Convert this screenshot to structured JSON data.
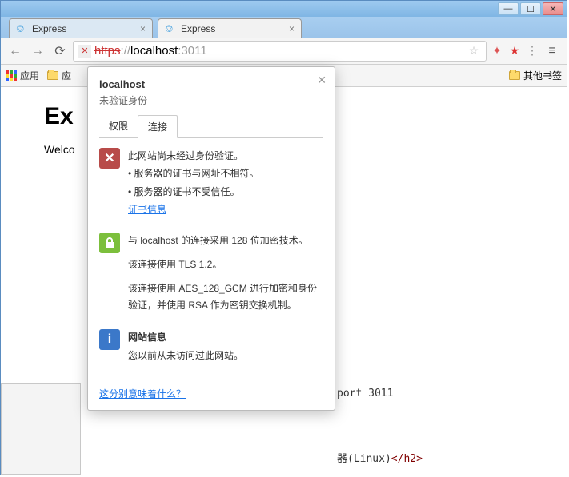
{
  "window": {
    "min": "—",
    "max": "☐",
    "close": "✕"
  },
  "tabs": [
    {
      "title": "Express",
      "active": false
    },
    {
      "title": "Express",
      "active": true
    }
  ],
  "toolbar": {
    "back": "←",
    "forward": "→",
    "reload": "⟳",
    "menu": "≡",
    "star": "☆",
    "ext1": "✦",
    "ext2": "★",
    "ext3": "⋮"
  },
  "url": {
    "scheme": "https",
    "slashes": "://",
    "host": "localhost",
    "port": ":3011",
    "warn": "✕"
  },
  "bookmarks": {
    "apps": "应用",
    "folder1": "应",
    "other": "其他书签"
  },
  "page": {
    "heading": "Ex",
    "welcome": "Welco"
  },
  "popup": {
    "title": "localhost",
    "subtitle": "未验证身份",
    "tab1": "权限",
    "tab2": "连接",
    "close": "✕",
    "sec1": {
      "icon": "✕",
      "line1": "此网站尚未经过身份验证。",
      "li1": "• 服务器的证书与网址不相符。",
      "li2": "• 服务器的证书不受信任。",
      "link": "证书信息"
    },
    "sec2": {
      "icon_lock": "🔒",
      "line1": "与 localhost 的连接采用 128 位加密技术。",
      "line2": "该连接使用 TLS 1.2。",
      "line3": "该连接使用 AES_128_GCM 进行加密和身份验证，并使用 RSA 作为密钥交换机制。"
    },
    "sec3": {
      "icon": "i",
      "title": "网站信息",
      "line1": "您以前从未访问过此网站。"
    },
    "footer_link": "这分别意味着什么？"
  },
  "bg": {
    "port_text": "port 3011",
    "linux_pre": "器(Linux)",
    "linux_close": "</h2>"
  }
}
